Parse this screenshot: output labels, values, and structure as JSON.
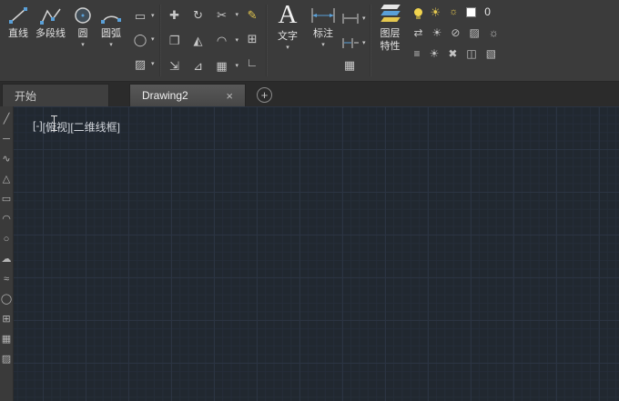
{
  "colors": {
    "ribbon_bg": "#3b3b3b",
    "tabbar_bg": "#2b2b2b",
    "tab_active_bg": "#4a4a4a",
    "tab_inactive_bg": "#3f3f3f",
    "canvas_bg": "#212830",
    "grid_minor": "#252d39",
    "grid_major": "#2b3442",
    "icon_color": "#c9c9c9",
    "accent_yellow": "#e5c84f",
    "accent_blue": "#5aa0d8",
    "layer_swatch": "#ffffff"
  },
  "ribbon": {
    "dropdown_glyph": "▾",
    "draw": {
      "tools": [
        {
          "label": "直线"
        },
        {
          "label": "多段线"
        },
        {
          "label": "圆"
        },
        {
          "label": "圆弧"
        }
      ],
      "flyout": [
        {
          "glyph": "▭"
        },
        {
          "glyph": "◯"
        },
        {
          "glyph": "▨"
        }
      ]
    },
    "modify": {
      "rows": [
        [
          "✚",
          "↻",
          "✂"
        ],
        [
          "❐",
          "◭",
          "◠"
        ],
        [
          "⇲",
          "⊿",
          "▦"
        ]
      ]
    },
    "utility": [
      "✎",
      "⊞",
      "∟"
    ],
    "text_panel": {
      "big_a": "A",
      "label": "文字"
    },
    "annotate": {
      "label": "标注",
      "table_glyph": "▦"
    },
    "layer_props": {
      "label_line1": "图层",
      "label_line2": "特性"
    },
    "layers": {
      "current_layer": "0",
      "row2": [
        "⇄",
        "☀",
        "⊘",
        "▨",
        "☼"
      ],
      "row3": [
        "≡",
        "☀",
        "✖",
        "◫",
        "▧"
      ]
    }
  },
  "tabs": {
    "start": {
      "label": "开始"
    },
    "drawing": {
      "label": "Drawing2",
      "close": "×"
    },
    "new_tab": "+"
  },
  "canvas": {
    "viewport_controls": [
      {
        "label": "[-]"
      },
      {
        "label": "[俯视]"
      },
      {
        "label": "[二维线框]"
      }
    ]
  },
  "left_toolbar": {
    "items": [
      {
        "name": "line",
        "glyph": "╱"
      },
      {
        "name": "construction-line",
        "glyph": "─"
      },
      {
        "name": "polyline",
        "glyph": "∿"
      },
      {
        "name": "polygon",
        "glyph": "△"
      },
      {
        "name": "rectangle",
        "glyph": "▭"
      },
      {
        "name": "arc",
        "glyph": "◠"
      },
      {
        "name": "circle",
        "glyph": "○"
      },
      {
        "name": "revision-cloud",
        "glyph": "☁"
      },
      {
        "name": "spline",
        "glyph": "≈"
      },
      {
        "name": "ellipse",
        "glyph": "◯"
      },
      {
        "name": "insert-block",
        "glyph": "⊞"
      },
      {
        "name": "table",
        "glyph": "▦"
      },
      {
        "name": "hatch",
        "glyph": "▨"
      }
    ]
  }
}
